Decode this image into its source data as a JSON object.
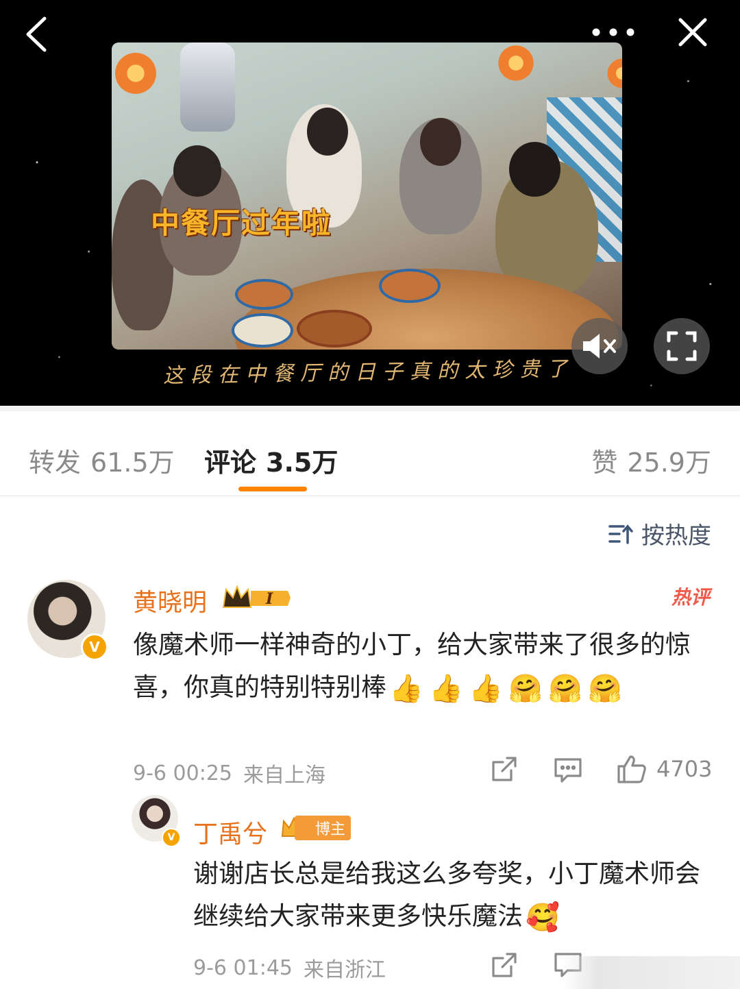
{
  "video": {
    "overlay_title": "中餐厅过年啦",
    "subtitle": "这段在中餐厅的日子真的太珍贵了"
  },
  "tabs": {
    "repost_label": "转发",
    "repost_count": "61.5万",
    "comment_label": "评论",
    "comment_count": "3.5万",
    "like_label": "赞",
    "like_count": "25.9万",
    "active": "comment"
  },
  "sort": {
    "label": "按热度"
  },
  "comments": [
    {
      "user": "黄晓明",
      "level": "I",
      "badge": "热评",
      "text": "像魔术师一样神奇的小丁，给大家带来了很多的惊喜，你真的特别特别棒",
      "emojis": [
        "👍",
        "👍",
        "👍",
        "🤗",
        "🤗",
        "🤗"
      ],
      "date": "9-6 00:25",
      "location": "来自上海",
      "likes": "4703"
    },
    {
      "user": "丁禹兮",
      "tag": "博主",
      "text": "谢谢店长总是给我这么多夸奖，小丁魔术师会继续给大家带来更多快乐魔法",
      "emoji": "🥰",
      "date": "9-6 01:45",
      "location": "来自浙江"
    }
  ],
  "colors": {
    "accent": "#ff8200",
    "username": "#e8711c",
    "hot": "#f15a4a",
    "verified": "#f5a300"
  }
}
